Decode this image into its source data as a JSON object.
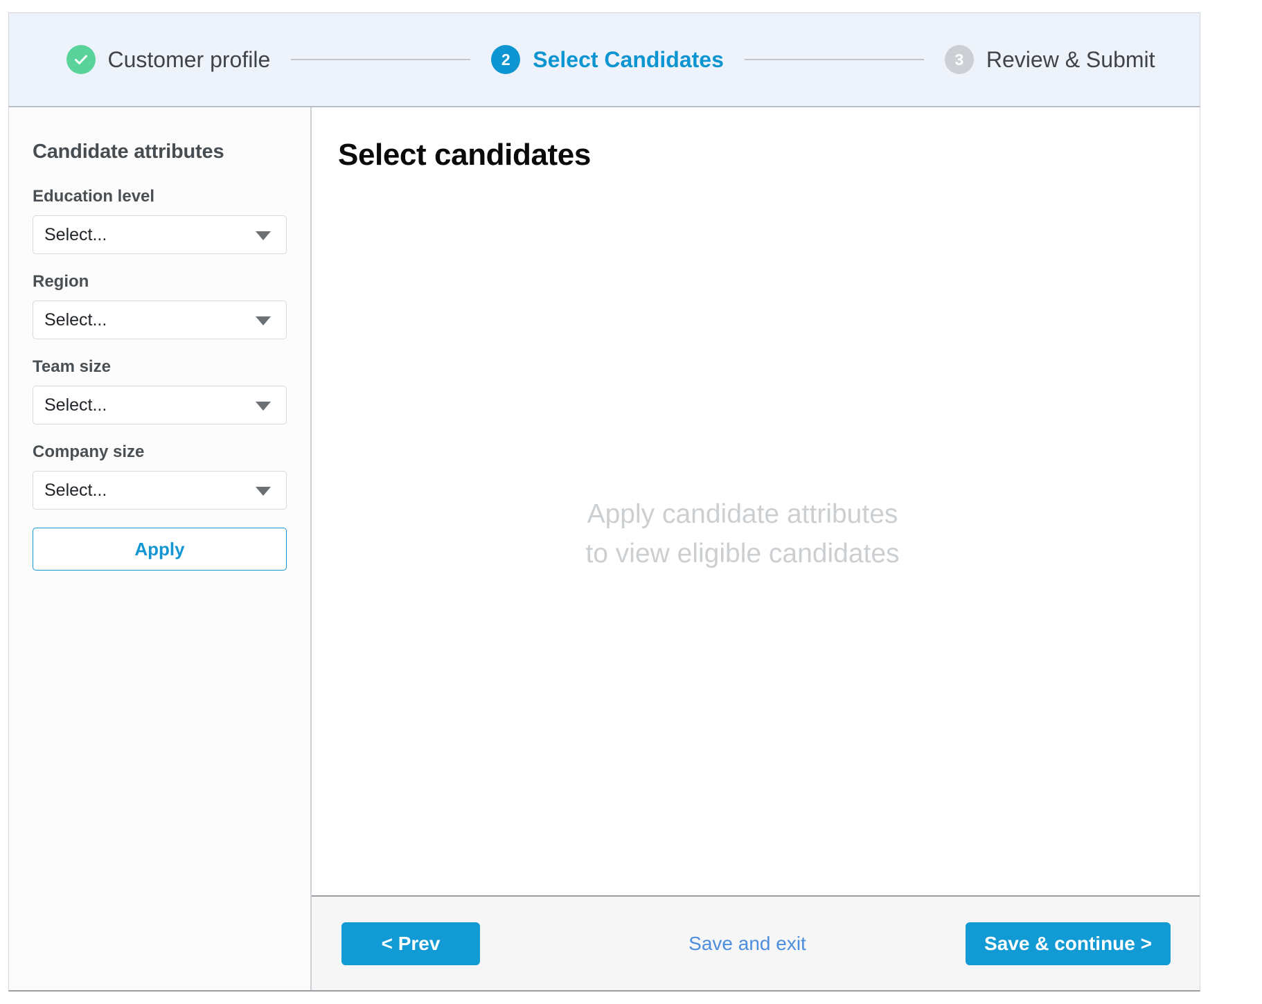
{
  "stepper": {
    "steps": [
      {
        "marker": "check-icon",
        "number": "",
        "label": "Customer profile",
        "state": "done"
      },
      {
        "marker": "number",
        "number": "2",
        "label": "Select Candidates",
        "state": "current"
      },
      {
        "marker": "number",
        "number": "3",
        "label": "Review & Submit",
        "state": "todo"
      }
    ]
  },
  "sidebar": {
    "title": "Candidate attributes",
    "fields": [
      {
        "label": "Education level",
        "value": "Select..."
      },
      {
        "label": "Region",
        "value": "Select..."
      },
      {
        "label": "Team size",
        "value": "Select..."
      },
      {
        "label": "Company size",
        "value": "Select..."
      }
    ],
    "apply_label": "Apply"
  },
  "main": {
    "title": "Select candidates",
    "empty_line1": "Apply candidate attributes",
    "empty_line2": "to view eligible candidates"
  },
  "footer": {
    "prev_label": "< Prev",
    "save_exit_label": "Save and exit",
    "continue_label": "Save & continue >"
  },
  "colors": {
    "accent_blue": "#119ad3",
    "step_current_blue": "#0d95d1",
    "step_done_green": "#5ad39b",
    "step_todo_grey": "#ccd0d4",
    "link_blue": "#4c8ddd",
    "header_bg": "#eef2fa",
    "placeholder_grey": "#cccfd2"
  }
}
